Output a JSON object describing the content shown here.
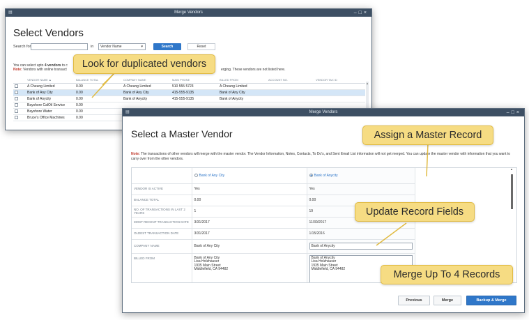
{
  "select_window": {
    "title": "Merge Vendors",
    "heading": "Select Vendors",
    "search_label": "Search for",
    "search_value": "",
    "in_label": "in",
    "search_in_selected": "Vendor Name",
    "search_button": "Search",
    "reset_button": "Reset",
    "info_line_prefix": "You can select upto",
    "info_line_bold": "4 vendors",
    "info_line_suffix": "to c",
    "note_label": "Note:",
    "note_text": "Vendors with online transact",
    "note_tail": "erging. These vendors are not listed here.",
    "columns": [
      "VENDOR NAME ▲",
      "BALANCE TOTAL",
      "COMPANY NAME",
      "MAIN PHONE",
      "BILLED FROM",
      "ACCOUNT NO.",
      "VENDOR TAX ID"
    ],
    "rows": [
      {
        "name": "A Cheung Limited",
        "balance": "0.00",
        "company": "A Cheung Limited",
        "phone": "510 555 5723",
        "billed": "A Cheung Limited",
        "selected": false
      },
      {
        "name": "Bank of Any City",
        "balance": "0.00",
        "company": "Bank of Any City",
        "phone": "415-555-9135",
        "billed": "Bank of Any City",
        "selected": true
      },
      {
        "name": "Bank of Anycity",
        "balance": "0.00",
        "company": "Bank of Anycity",
        "phone": "415-555-9135",
        "billed": "Bank of Anycity",
        "selected": false
      },
      {
        "name": "Bayshore CalOil Service",
        "balance": "0.00",
        "company": "",
        "phone": "",
        "billed": "",
        "selected": false
      },
      {
        "name": "Bayshore Water",
        "balance": "0.00",
        "company": "",
        "phone": "",
        "billed": "",
        "selected": false
      },
      {
        "name": "Bruce's Office Machines",
        "balance": "0.00",
        "company": "",
        "phone": "",
        "billed": "",
        "selected": false
      }
    ]
  },
  "master_window": {
    "title": "Merge Vendors",
    "heading": "Select a Master Vendor",
    "note_label": "Note:",
    "note_text": "The transactions of other vendors will merge with the master vendor. The Vendor Information, Notes, Contacts, To Do's, and Sent Email List information will not get merged. You can update the master vendor with information that you want to carry over from the other vendors.",
    "option_a": "Bank of Any City",
    "option_b": "Bank of Anycity",
    "selected_option": "b",
    "rows": [
      {
        "label": "VENDOR IS ACTIVE",
        "a": "Yes",
        "b": "Yes"
      },
      {
        "label": "BALANCE TOTAL",
        "a": "0.00",
        "b": "0.00"
      },
      {
        "label": "NO. OF TRANSACTIONS IN LAST 2 YEARS",
        "a": "1",
        "b": "19"
      },
      {
        "label": "MOST RECENT TRANSACTION DATE",
        "a": "3/31/2017",
        "b": "11/30/2017"
      },
      {
        "label": "OLDEST TRANSACTION DATE",
        "a": "3/31/2017",
        "b": "1/15/2016"
      }
    ],
    "company_label": "COMPANY NAME",
    "company_a": "Bank of Any City",
    "company_b": "Bank of Anycity",
    "billed_label": "BILLED FROM",
    "billed_a": [
      "Bank of Any City",
      "Lisa Holzhauser",
      "1935 Main Street",
      "Middlefield, CA 94482"
    ],
    "billed_b": [
      "Bank of Anycity",
      "Lisa Holzhauser",
      "1935 Main Street",
      "Middlefield, CA 94482"
    ],
    "previous_button": "Previous",
    "merge_button": "Merge",
    "backup_merge_button": "Backup & Merge"
  },
  "callouts": {
    "duplicates": "Look for duplicated vendors",
    "master": "Assign a Master Record",
    "update": "Update Record Fields",
    "merge4": "Merge Up To 4 Records"
  },
  "colors": {
    "accent": "#2f77c9",
    "titlebar": "#3d4f63",
    "callout_fill": "#f6dc83",
    "callout_border": "#e1bb43",
    "note_red": "#c0392b"
  }
}
